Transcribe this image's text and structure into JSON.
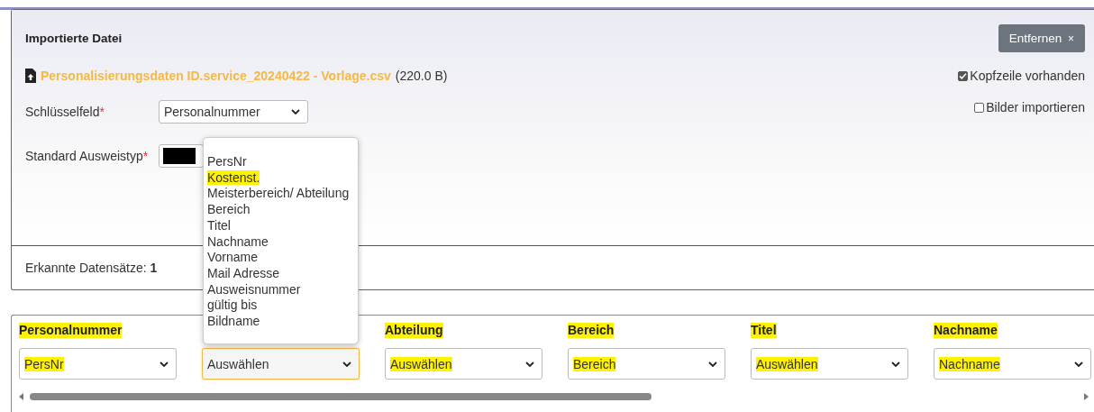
{
  "panel": {
    "title": "Importierte Datei",
    "remove_button": {
      "label": "Entfernen",
      "icon": "×"
    },
    "file": {
      "name": "Personalisierungsdaten ID.service_20240422 - Vorlage.csv",
      "size": "(220.0 B)"
    },
    "options": [
      {
        "label": "Kopfzeile vorhanden",
        "checked": true
      },
      {
        "label": "Bilder importieren",
        "checked": false
      }
    ],
    "fields": [
      {
        "label": "Schlüsselfeld",
        "required_mark": "*",
        "kind": "select",
        "value": "Personalnummer"
      },
      {
        "label": "Standard Ausweistyp",
        "required_mark": "*",
        "kind": "redacted"
      }
    ],
    "records": {
      "label": "Erkannte Datensätze:",
      "count": "1"
    }
  },
  "mapping": {
    "columns": [
      {
        "heading": "Personalnummer",
        "heading_highlighted": true,
        "value": "PersNr",
        "value_highlighted": true,
        "focused": false
      },
      {
        "value": "Auswählen",
        "value_highlighted": false,
        "focused": true
      },
      {
        "heading": "Abteilung",
        "heading_highlighted": true,
        "value": "Auswählen",
        "value_highlighted": true,
        "focused": false
      },
      {
        "heading": "Bereich",
        "heading_highlighted": true,
        "value": "Bereich",
        "value_highlighted": true,
        "focused": false
      },
      {
        "heading": "Titel",
        "heading_highlighted": true,
        "value": "Auswählen",
        "value_highlighted": true,
        "focused": false
      },
      {
        "heading": "Nachname",
        "heading_highlighted": true,
        "value": "Nachname",
        "value_highlighted": true,
        "focused": false
      }
    ],
    "dropdown_options": [
      {
        "label": "PersNr",
        "highlighted": false
      },
      {
        "label": "Kostenst.",
        "highlighted": true
      },
      {
        "label": "Meisterbereich/ Abteilung",
        "highlighted": false
      },
      {
        "label": "Bereich",
        "highlighted": false
      },
      {
        "label": "Titel",
        "highlighted": false
      },
      {
        "label": "Nachname",
        "highlighted": false
      },
      {
        "label": "Vorname",
        "highlighted": false
      },
      {
        "label": "Mail Adresse",
        "highlighted": false
      },
      {
        "label": "Ausweisnummer",
        "highlighted": false
      },
      {
        "label": "gültig bis",
        "highlighted": false
      },
      {
        "label": "Bildname",
        "highlighted": false
      }
    ]
  }
}
